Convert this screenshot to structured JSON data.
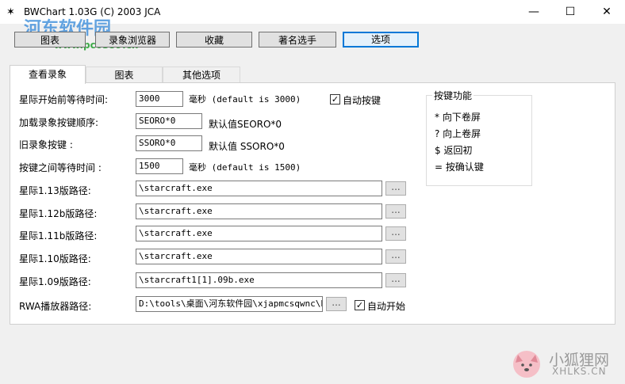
{
  "window": {
    "title": "BWChart 1.03G (C) 2003 JCA",
    "icon": "bwchart-icon",
    "minimize": "—",
    "maximize": "☐",
    "close": "✕"
  },
  "watermark": {
    "site_name": "河东软件园",
    "url": "www.pc0359.cn",
    "corner_cn": "小狐狸网",
    "corner_en": "XHLKS.CN"
  },
  "toolbar": {
    "buttons": [
      "图表",
      "录象浏览器",
      "收藏",
      "著名选手",
      "选项"
    ],
    "active": "选项"
  },
  "tabs": {
    "items": [
      "查看录象",
      "图表",
      "其他选项"
    ],
    "active": "查看录象"
  },
  "form": {
    "start_wait_label": "星际开始前等待时间:",
    "start_wait_value": "3000",
    "start_wait_hint": "毫秒 (default is 3000)",
    "auto_key_label": "自动按键",
    "auto_key_checked": true,
    "load_order_label": "加载录象按键顺序:",
    "load_order_value": "SEORO*0",
    "load_order_hint": "默认值SEORO*0",
    "old_key_label": "旧录象按键 :",
    "old_key_value": "SSORO*0",
    "old_key_hint": "默认值 SSORO*0",
    "key_wait_label": "按键之间等待时间 :",
    "key_wait_value": "1500",
    "key_wait_hint": "毫秒 (default is 1500)",
    "paths": [
      {
        "label": "星际1.13版路径:",
        "value": "\\starcraft.exe"
      },
      {
        "label": "星际1.12b版路径:",
        "value": "\\starcraft.exe"
      },
      {
        "label": "星际1.11b版路径:",
        "value": "\\starcraft.exe"
      },
      {
        "label": "星际1.10版路径:",
        "value": "\\starcraft.exe"
      },
      {
        "label": "星际1.09版路径:",
        "value": "\\starcraft1[1].09b.exe"
      }
    ],
    "browse_label": "...",
    "rwa_label": "RWA播放器路径:",
    "rwa_value": "D:\\tools\\桌面\\河东软件园\\xjapmcsqwnc\\bw",
    "auto_start_label": "自动开始",
    "auto_start_checked": true
  },
  "shortcuts": {
    "title": "按键功能",
    "items": [
      "* 向下卷屏",
      "? 向上卷屏",
      "$ 返回初",
      "= 按确认键"
    ]
  },
  "colors": {
    "active_button_border": "#0078d7",
    "watermark_blue": "#2f86d8",
    "watermark_green": "#1d9e2a"
  }
}
